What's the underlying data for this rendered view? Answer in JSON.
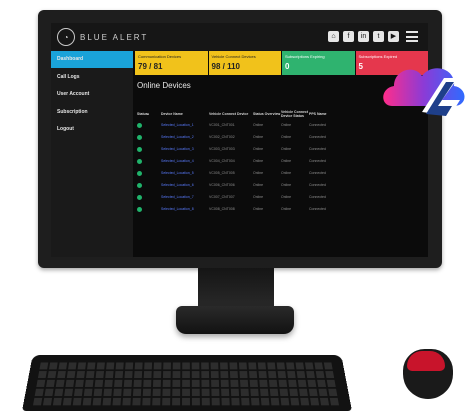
{
  "app": {
    "brand": "BLUE ALERT"
  },
  "colors": {
    "active_nav": "#1aa3d9",
    "card_yellow": "#f1c21b",
    "card_green": "#2fb36f",
    "card_red": "#e5374d",
    "online_dot": "#20b36b"
  },
  "topbar_icons": [
    "home-icon",
    "facebook-icon",
    "linkedin-icon",
    "twitter-icon",
    "youtube-icon",
    "menu-icon"
  ],
  "sidebar": {
    "items": [
      {
        "label": "Dashboard",
        "active": true
      },
      {
        "label": "Call Logs",
        "active": false
      },
      {
        "label": "User Account",
        "active": false
      },
      {
        "label": "Subscription",
        "active": false
      },
      {
        "label": "Logout",
        "active": false
      }
    ]
  },
  "cards": [
    {
      "title": "Communication Devices",
      "value": "79 / 81",
      "color": "yellow"
    },
    {
      "title": "Vehicle Connect Devices",
      "value": "98 / 110",
      "color": "yellow"
    },
    {
      "title": "Subscriptions Expiring",
      "value": "0",
      "color": "green"
    },
    {
      "title": "Subscriptions Expired",
      "value": "5",
      "color": "red"
    }
  ],
  "main": {
    "section_title": "Online Devices"
  },
  "table": {
    "headers": [
      "Status",
      "",
      "Device Name",
      "Vehicle Connect Device",
      "Status Overview",
      "Vehicle Connect Device Status",
      "PPS Name",
      ""
    ],
    "rows": [
      {
        "name": "Selected_Location_1",
        "device": "VC001_CNT001",
        "overview": "Online",
        "vstatus": "Online",
        "pps": "Connected"
      },
      {
        "name": "Selected_Location_2",
        "device": "VC002_CNT002",
        "overview": "Online",
        "vstatus": "Online",
        "pps": "Connected"
      },
      {
        "name": "Selected_Location_3",
        "device": "VC003_CNT003",
        "overview": "Online",
        "vstatus": "Online",
        "pps": "Connected"
      },
      {
        "name": "Selected_Location_4",
        "device": "VC004_CNT004",
        "overview": "Online",
        "vstatus": "Online",
        "pps": "Connected"
      },
      {
        "name": "Selected_Location_5",
        "device": "VC005_CNT005",
        "overview": "Online",
        "vstatus": "Online",
        "pps": "Connected"
      },
      {
        "name": "Selected_Location_6",
        "device": "VC006_CNT006",
        "overview": "Online",
        "vstatus": "Online",
        "pps": "Connected"
      },
      {
        "name": "Selected_Location_7",
        "device": "VC007_CNT007",
        "overview": "Online",
        "vstatus": "Online",
        "pps": "Connected"
      },
      {
        "name": "Selected_Location_8",
        "device": "VC008_CNT008",
        "overview": "Online",
        "vstatus": "Online",
        "pps": "Connected"
      }
    ]
  }
}
